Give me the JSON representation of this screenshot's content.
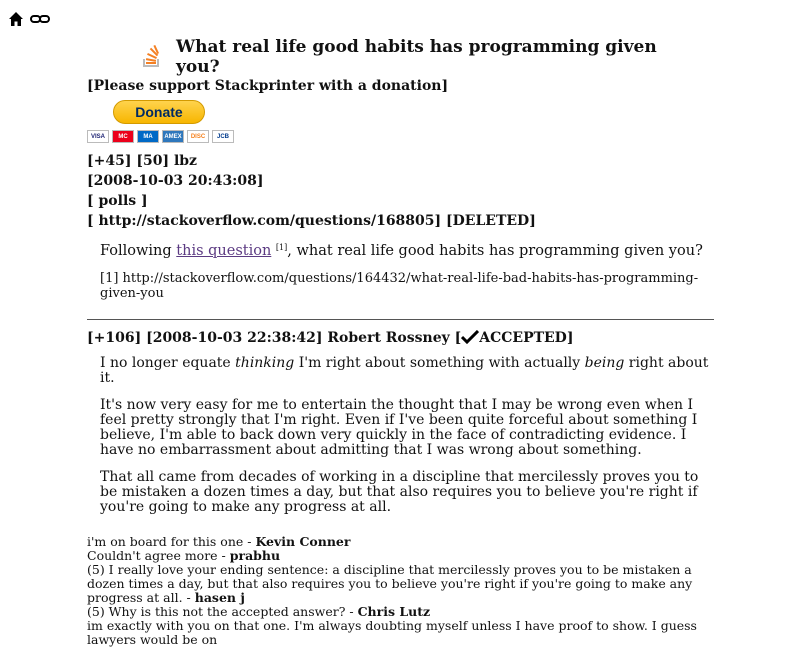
{
  "nav": {
    "home_icon": "home-icon",
    "link_icon": "link-icon"
  },
  "header": {
    "title": "What real life good habits has programming given you?"
  },
  "donation": {
    "support_text": "[Please support Stackprinter with a donation]",
    "donate_label": "Donate",
    "card_labels": [
      "VISA",
      "MC",
      "MA",
      "AMEX",
      "DISC",
      "JCB"
    ]
  },
  "question": {
    "score": "[+45]",
    "answers": "[50]",
    "author": "lbz",
    "timestamp": "[2008-10-03 20:43:08]",
    "tags": "[ polls ]",
    "url_line": "[ http://stackoverflow.com/questions/168805] [DELETED]",
    "body_prefix": "Following ",
    "link_text": "this question",
    "footnote_mark": "[1]",
    "body_suffix": ", what real life good habits has programming given you?",
    "reference": "[1] http://stackoverflow.com/questions/164432/what-real-life-bad-habits-has-programming-given-you"
  },
  "answer": {
    "header": "[+106] [2008-10-03 22:38:42] Robert Rossney [",
    "accepted": "ACCEPTED]",
    "p1_a": "I no longer equate ",
    "p1_em1": "thinking",
    "p1_b": " I'm right about something with actually ",
    "p1_em2": "being",
    "p1_c": " right about it.",
    "p2": "It's now very easy for me to entertain the thought that I may be wrong even when I feel pretty strongly that I'm right. Even if I've been quite forceful about something I believe, I'm able to back down very quickly in the face of contradicting evidence. I have no embarrassment about admitting that I was wrong about something.",
    "p3": "That all came from decades of working in a discipline that mercilessly proves you to be mistaken a dozen times a day, but that also requires you to believe you're right if you're going to make any progress at all."
  },
  "comments": [
    {
      "text": "i'm on board for this one - ",
      "author": "Kevin Conner"
    },
    {
      "text": "Couldn't agree more - ",
      "author": "prabhu"
    },
    {
      "text": "(5) I really love your ending sentence: a discipline that mercilessly proves you to be mistaken a dozen times a day, but that also requires you to believe you're right if you're going to make any progress at all. - ",
      "author": "hasen j"
    },
    {
      "text": "(5) Why is this not the accepted answer? - ",
      "author": "Chris Lutz"
    },
    {
      "text": "im exactly with you on that one. I'm always doubting myself unless I have proof to show. I guess lawyers would be on",
      "author": ""
    }
  ]
}
